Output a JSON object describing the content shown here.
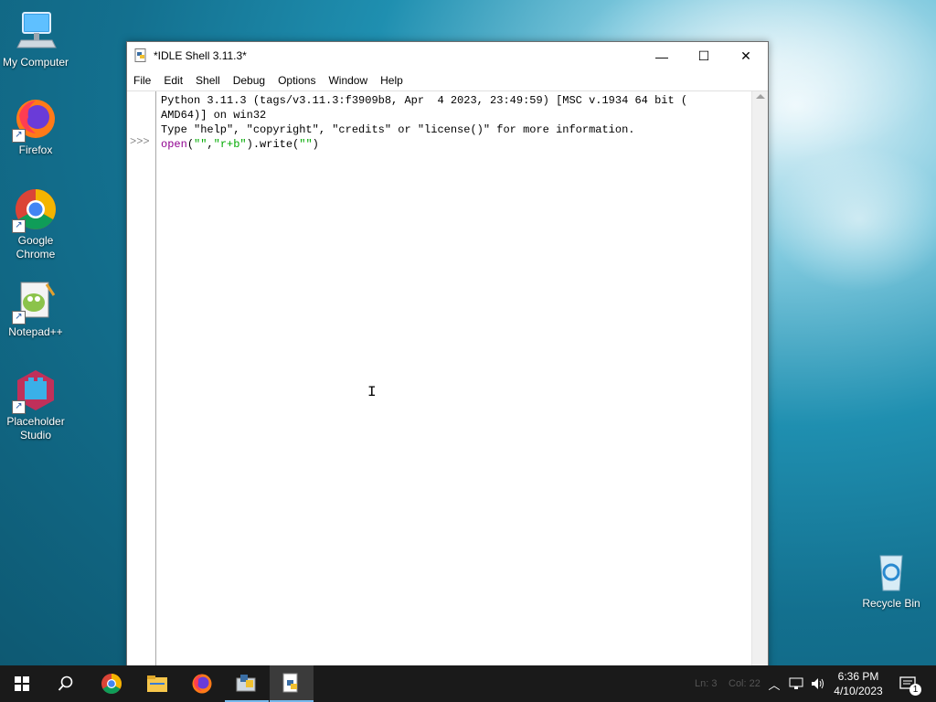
{
  "desktop": {
    "icons": [
      {
        "label": "My Computer"
      },
      {
        "label": "Firefox"
      },
      {
        "label": "Google Chrome"
      },
      {
        "label": "Notepad++"
      },
      {
        "label": "Placeholder Studio"
      },
      {
        "label": "Recycle Bin"
      }
    ]
  },
  "window": {
    "title": "*IDLE Shell 3.11.3*",
    "controls": {
      "minimize": "—",
      "maximize": "☐",
      "close": "✕"
    },
    "menu": [
      "File",
      "Edit",
      "Shell",
      "Debug",
      "Options",
      "Window",
      "Help"
    ],
    "shell": {
      "banner_line1": "Python 3.11.3 (tags/v3.11.3:f3909b8, Apr  4 2023, 23:49:59) [MSC v.1934 64 bit (",
      "banner_line2": "AMD64)] on win32",
      "banner_line3": "Type \"help\", \"copyright\", \"credits\" or \"license()\" for more information.",
      "prompt": ">>>",
      "input": {
        "fn": "open",
        "p1": "(",
        "s1": "\"\"",
        "comma": ",",
        "s2": "\"r+b\"",
        "p2": ").write(",
        "s3": "\"\"",
        "p3": ")"
      }
    },
    "statusbar": {
      "line": "Ln: 3",
      "col": "Col: 22"
    }
  },
  "taskbar": {
    "apps": [
      "start-icon",
      "search-icon",
      "chrome-icon",
      "file-explorer-icon",
      "firefox-icon",
      "python-idle-icon",
      "python-file-icon"
    ],
    "clock": {
      "time": "6:36 PM",
      "date": "4/10/2023"
    },
    "notifications_count": "1"
  },
  "colors": {
    "builtin": "#900090",
    "string": "#00aa00",
    "taskbar": "#1a1a1a",
    "accent": "#76b9ed"
  }
}
